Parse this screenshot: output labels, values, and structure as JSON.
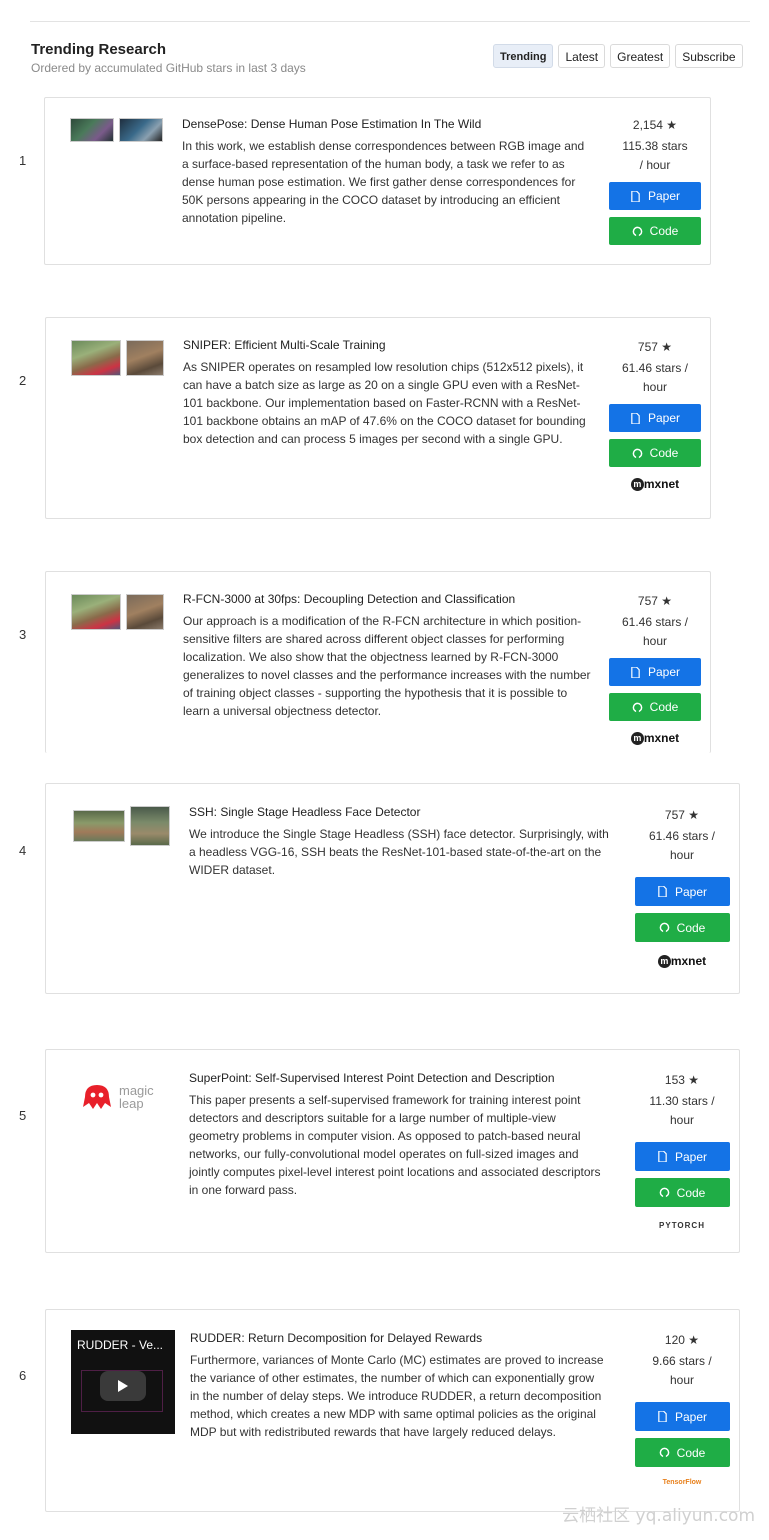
{
  "header": {
    "title": "Trending Research",
    "subtitle": "Ordered by accumulated GitHub stars in last 3 days",
    "tabs": [
      "Trending",
      "Latest",
      "Greatest",
      "Subscribe"
    ]
  },
  "buttons": {
    "paper": "Paper",
    "code": "Code"
  },
  "star_glyph": "★",
  "papers": [
    {
      "rank": "1",
      "title": "DensePose: Dense Human Pose Estimation In The Wild",
      "abstract": "In this work, we establish dense correspondences between RGB image and a surface-based representation of the human body, a task we refer to as dense human pose estimation. We first gather dense correspondences for 50K persons appearing in the COCO dataset by introducing an efficient annotation pipeline.",
      "stars": "2,154",
      "rate": "115.38 stars / hour",
      "framework": ""
    },
    {
      "rank": "2",
      "title": "SNIPER: Efficient Multi-Scale Training",
      "abstract": "As SNIPER operates on resampled low resolution chips (512x512 pixels), it can have a batch size as large as 20 on a single GPU even with a ResNet-101 backbone. Our implementation based on Faster-RCNN with a ResNet-101 backbone obtains an mAP of 47.6% on the COCO dataset for bounding box detection and can process 5 images per second with a single GPU.",
      "stars": "757",
      "rate": "61.46 stars / hour",
      "framework": "mxnet"
    },
    {
      "rank": "3",
      "title": "R-FCN-3000 at 30fps: Decoupling Detection and Classification",
      "abstract": "Our approach is a modification of the R-FCN architecture in which position-sensitive filters are shared across different object classes for performing localization. We also show that the objectness learned by R-FCN-3000 generalizes to novel classes and the performance increases with the number of training object classes - supporting the hypothesis that it is possible to learn a universal objectness detector.",
      "stars": "757",
      "rate": "61.46 stars / hour",
      "framework": "mxnet"
    },
    {
      "rank": "4",
      "title": "SSH: Single Stage Headless Face Detector",
      "abstract": "We introduce the Single Stage Headless (SSH) face detector. Surprisingly, with a headless VGG-16, SSH beats the ResNet-101-based state-of-the-art on the WIDER dataset.",
      "stars": "757",
      "rate": "61.46 stars / hour",
      "framework": "mxnet"
    },
    {
      "rank": "5",
      "title": "SuperPoint: Self-Supervised Interest Point Detection and Description",
      "abstract": "This paper presents a self-supervised framework for training interest point detectors and descriptors suitable for a large number of multiple-view geometry problems in computer vision. As opposed to patch-based neural networks, our fully-convolutional model operates on full-sized images and jointly computes pixel-level interest point locations and associated descriptors in one forward pass.",
      "stars": "153",
      "rate": "11.30 stars / hour",
      "framework": "PYTORCH",
      "logo_text": "magic leap"
    },
    {
      "rank": "6",
      "title": "RUDDER: Return Decomposition for Delayed Rewards",
      "abstract": "Furthermore, variances of Monte Carlo (MC) estimates are proved to increase the variance of other estimates, the number of which can exponentially grow in the number of delay steps. We introduce RUDDER, a return decomposition method, which creates a new MDP with same optimal policies as the original MDP but with redistributed rewards that have largely reduced delays.",
      "stars": "120",
      "rate": "9.66 stars / hour",
      "framework": "TensorFlow",
      "video_title": "RUDDER - Ve..."
    }
  ],
  "watermark": "云栖社区 yq.aliyun.com",
  "colors": {
    "paper_button": "#1473e6",
    "code_button": "#1fad46",
    "active_tab": "#e8eef7"
  }
}
